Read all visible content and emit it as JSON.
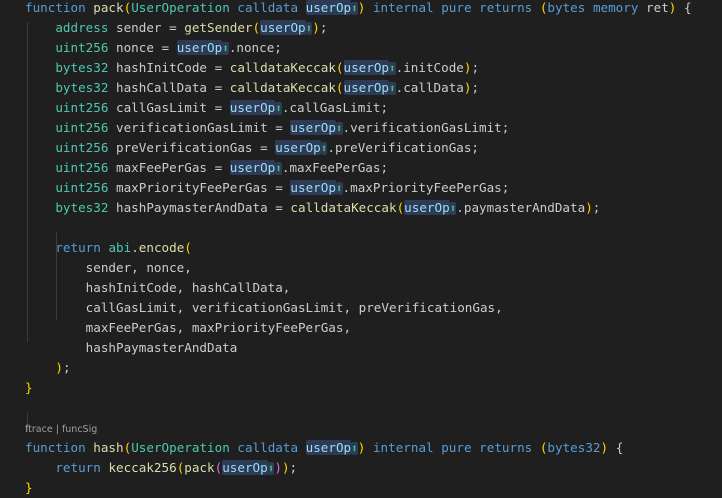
{
  "colors": {
    "background": "#1f1f1f",
    "keyword": "#569cd6",
    "type": "#4ec9b0",
    "function": "#dcdcaa",
    "variable": "#9cdcfe",
    "text": "#cccccc",
    "paren_outer": "#ffd700",
    "paren_inner": "#da70d6",
    "paren_third": "#179fff",
    "data_location": "#569cd6",
    "highlight": "#2d3b55",
    "arrow": "#3fbf8f"
  },
  "code_lens": "ftrace | funcSig",
  "lines": [
    [
      [
        "kw",
        "function"
      ],
      [
        "sp",
        " "
      ],
      [
        "fn",
        "pack"
      ],
      [
        "p1",
        "("
      ],
      [
        "ty",
        "UserOperation"
      ],
      [
        "sp",
        " "
      ],
      [
        "kw",
        "calldata"
      ],
      [
        "sp",
        " "
      ],
      [
        "vh",
        "userOp"
      ],
      [
        "ar",
        "⬆"
      ],
      [
        "p1",
        ")"
      ],
      [
        "sp",
        " "
      ],
      [
        "kw",
        "internal"
      ],
      [
        "sp",
        " "
      ],
      [
        "kw",
        "pure"
      ],
      [
        "sp",
        " "
      ],
      [
        "kw",
        "returns"
      ],
      [
        "sp",
        " "
      ],
      [
        "p1",
        "("
      ],
      [
        "kw",
        "bytes"
      ],
      [
        "sp",
        " "
      ],
      [
        "kw",
        "memory"
      ],
      [
        "sp",
        " "
      ],
      [
        "tx",
        "ret"
      ],
      [
        "p1",
        ")"
      ],
      [
        "sp",
        " "
      ],
      [
        "tx",
        "{"
      ]
    ],
    [
      [
        "sp",
        "    "
      ],
      [
        "ty",
        "address"
      ],
      [
        "sp",
        " "
      ],
      [
        "tx",
        "sender = "
      ],
      [
        "fn",
        "getSender"
      ],
      [
        "p1",
        "("
      ],
      [
        "vh",
        "userOp"
      ],
      [
        "ar",
        "⬆"
      ],
      [
        "p1",
        ")"
      ],
      [
        "tx",
        ";"
      ]
    ],
    [
      [
        "sp",
        "    "
      ],
      [
        "ty",
        "uint256"
      ],
      [
        "sp",
        " "
      ],
      [
        "tx",
        "nonce = "
      ],
      [
        "vh",
        "userOp"
      ],
      [
        "ar",
        "⬆"
      ],
      [
        "tx",
        ".nonce;"
      ]
    ],
    [
      [
        "sp",
        "    "
      ],
      [
        "ty",
        "bytes32"
      ],
      [
        "sp",
        " "
      ],
      [
        "tx",
        "hashInitCode = "
      ],
      [
        "fn",
        "calldataKeccak"
      ],
      [
        "p1",
        "("
      ],
      [
        "vh",
        "userOp"
      ],
      [
        "ar",
        "⬆"
      ],
      [
        "tx",
        ".initCode"
      ],
      [
        "p1",
        ")"
      ],
      [
        "tx",
        ";"
      ]
    ],
    [
      [
        "sp",
        "    "
      ],
      [
        "ty",
        "bytes32"
      ],
      [
        "sp",
        " "
      ],
      [
        "tx",
        "hashCallData = "
      ],
      [
        "fn",
        "calldataKeccak"
      ],
      [
        "p1",
        "("
      ],
      [
        "vh",
        "userOp"
      ],
      [
        "ar",
        "⬆"
      ],
      [
        "tx",
        ".callData"
      ],
      [
        "p1",
        ")"
      ],
      [
        "tx",
        ";"
      ]
    ],
    [
      [
        "sp",
        "    "
      ],
      [
        "ty",
        "uint256"
      ],
      [
        "sp",
        " "
      ],
      [
        "tx",
        "callGasLimit = "
      ],
      [
        "vh",
        "userOp"
      ],
      [
        "ar",
        "⬆"
      ],
      [
        "tx",
        ".callGasLimit;"
      ]
    ],
    [
      [
        "sp",
        "    "
      ],
      [
        "ty",
        "uint256"
      ],
      [
        "sp",
        " "
      ],
      [
        "tx",
        "verificationGasLimit = "
      ],
      [
        "vh",
        "userOp"
      ],
      [
        "ar",
        "⬆"
      ],
      [
        "tx",
        ".verificationGasLimit;"
      ]
    ],
    [
      [
        "sp",
        "    "
      ],
      [
        "ty",
        "uint256"
      ],
      [
        "sp",
        " "
      ],
      [
        "tx",
        "preVerificationGas = "
      ],
      [
        "vh",
        "userOp"
      ],
      [
        "ar",
        "⬆"
      ],
      [
        "tx",
        ".preVerificationGas;"
      ]
    ],
    [
      [
        "sp",
        "    "
      ],
      [
        "ty",
        "uint256"
      ],
      [
        "sp",
        " "
      ],
      [
        "tx",
        "maxFeePerGas = "
      ],
      [
        "vh",
        "userOp"
      ],
      [
        "ar",
        "⬆"
      ],
      [
        "tx",
        ".maxFeePerGas;"
      ]
    ],
    [
      [
        "sp",
        "    "
      ],
      [
        "ty",
        "uint256"
      ],
      [
        "sp",
        " "
      ],
      [
        "tx",
        "maxPriorityFeePerGas = "
      ],
      [
        "vh",
        "userOp"
      ],
      [
        "ar",
        "⬆"
      ],
      [
        "tx",
        ".maxPriorityFeePerGas;"
      ]
    ],
    [
      [
        "sp",
        "    "
      ],
      [
        "ty",
        "bytes32"
      ],
      [
        "sp",
        " "
      ],
      [
        "tx",
        "hashPaymasterAndData = "
      ],
      [
        "fn",
        "calldataKeccak"
      ],
      [
        "p1",
        "("
      ],
      [
        "vh",
        "userOp"
      ],
      [
        "ar",
        "⬆"
      ],
      [
        "tx",
        ".paymasterAndData"
      ],
      [
        "p1",
        ")"
      ],
      [
        "tx",
        ";"
      ]
    ],
    [],
    [
      [
        "sp",
        "    "
      ],
      [
        "kw",
        "return"
      ],
      [
        "sp",
        " "
      ],
      [
        "ty",
        "abi"
      ],
      [
        "tx",
        "."
      ],
      [
        "fn",
        "encode"
      ],
      [
        "p1",
        "("
      ]
    ],
    [
      [
        "sp",
        "        "
      ],
      [
        "tx",
        "sender, nonce,"
      ]
    ],
    [
      [
        "sp",
        "        "
      ],
      [
        "tx",
        "hashInitCode, hashCallData,"
      ]
    ],
    [
      [
        "sp",
        "        "
      ],
      [
        "tx",
        "callGasLimit, verificationGasLimit, preVerificationGas,"
      ]
    ],
    [
      [
        "sp",
        "        "
      ],
      [
        "tx",
        "maxFeePerGas, maxPriorityFeePerGas,"
      ]
    ],
    [
      [
        "sp",
        "        "
      ],
      [
        "tx",
        "hashPaymasterAndData"
      ]
    ],
    [
      [
        "sp",
        "    "
      ],
      [
        "p1",
        ")"
      ],
      [
        "tx",
        ";"
      ]
    ],
    [
      [
        "p0",
        "}"
      ]
    ],
    [],
    "LENS",
    [
      [
        "kw",
        "function"
      ],
      [
        "sp",
        " "
      ],
      [
        "fn",
        "hash"
      ],
      [
        "p1",
        "("
      ],
      [
        "ty",
        "UserOperation"
      ],
      [
        "sp",
        " "
      ],
      [
        "kw",
        "calldata"
      ],
      [
        "sp",
        " "
      ],
      [
        "vh",
        "userOp"
      ],
      [
        "ar",
        "⬆"
      ],
      [
        "p1",
        ")"
      ],
      [
        "sp",
        " "
      ],
      [
        "kw",
        "internal"
      ],
      [
        "sp",
        " "
      ],
      [
        "kw",
        "pure"
      ],
      [
        "sp",
        " "
      ],
      [
        "kw",
        "returns"
      ],
      [
        "sp",
        " "
      ],
      [
        "p1",
        "("
      ],
      [
        "kw",
        "bytes32"
      ],
      [
        "p1",
        ")"
      ],
      [
        "sp",
        " "
      ],
      [
        "tx",
        "{"
      ]
    ],
    [
      [
        "sp",
        "    "
      ],
      [
        "kw",
        "return"
      ],
      [
        "sp",
        " "
      ],
      [
        "fn",
        "keccak256"
      ],
      [
        "p1",
        "("
      ],
      [
        "fn",
        "pack"
      ],
      [
        "p2",
        "("
      ],
      [
        "vh",
        "userOp"
      ],
      [
        "ar",
        "⬆"
      ],
      [
        "p2",
        ")"
      ],
      [
        "p1",
        ")"
      ],
      [
        "tx",
        ";"
      ]
    ],
    [
      [
        "p0",
        "}"
      ]
    ]
  ]
}
